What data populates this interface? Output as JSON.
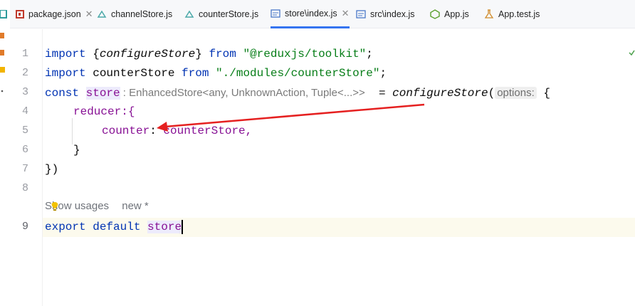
{
  "tabs": [
    {
      "label": "package.json",
      "icon": "json-file-icon",
      "closable": true,
      "active": false
    },
    {
      "label": "channelStore.js",
      "icon": "js-file-icon",
      "closable": false,
      "active": false
    },
    {
      "label": "counterStore.js",
      "icon": "js-file-icon",
      "closable": false,
      "active": false
    },
    {
      "label": "store\\index.js",
      "icon": "js-file-icon",
      "closable": true,
      "active": true
    },
    {
      "label": "src\\index.js",
      "icon": "js-file-icon",
      "closable": false,
      "active": false
    },
    {
      "label": "App.js",
      "icon": "nodejs-file-icon",
      "closable": false,
      "active": false
    },
    {
      "label": "App.test.js",
      "icon": "test-file-icon",
      "closable": false,
      "active": false
    }
  ],
  "close_glyph": "✕",
  "line_numbers": [
    "1",
    "2",
    "3",
    "4",
    "5",
    "6",
    "7",
    "8",
    "9"
  ],
  "code": {
    "l1": {
      "kw": "import",
      "open": " {",
      "name": "configureStore",
      "close": "} ",
      "from": "from",
      "str": " \"@reduxjs/toolkit\"",
      "semi": ";"
    },
    "l2": {
      "kw": "import",
      "name": " counterStore ",
      "from": "from",
      "str": " \"./modules/counterStore\"",
      "semi": ";"
    },
    "l3": {
      "kw": "const",
      "var": "store",
      "hint": " : EnhancedStore<any, UnknownAction, Tuple<...>>",
      "eq": "  = ",
      "fn": "configureStore",
      "paren": "(",
      "param": "options:",
      "brace": " {"
    },
    "l4": {
      "text": "reducer:{"
    },
    "l5": {
      "key": "counter",
      "colon": ": ",
      "val": "counterStore,"
    },
    "l6": {
      "text": "}"
    },
    "l7": {
      "text": "})"
    },
    "l9": {
      "kw1": "export",
      "kw2": "default",
      "var": "store"
    }
  },
  "inlay": {
    "usages": "Show usages",
    "status": "new *"
  },
  "colors": {
    "keyword": "#0033b3",
    "string": "#067d17",
    "variable": "#871094",
    "annotation_arrow": "#e52020",
    "active_tab_underline": "#3574f0"
  }
}
